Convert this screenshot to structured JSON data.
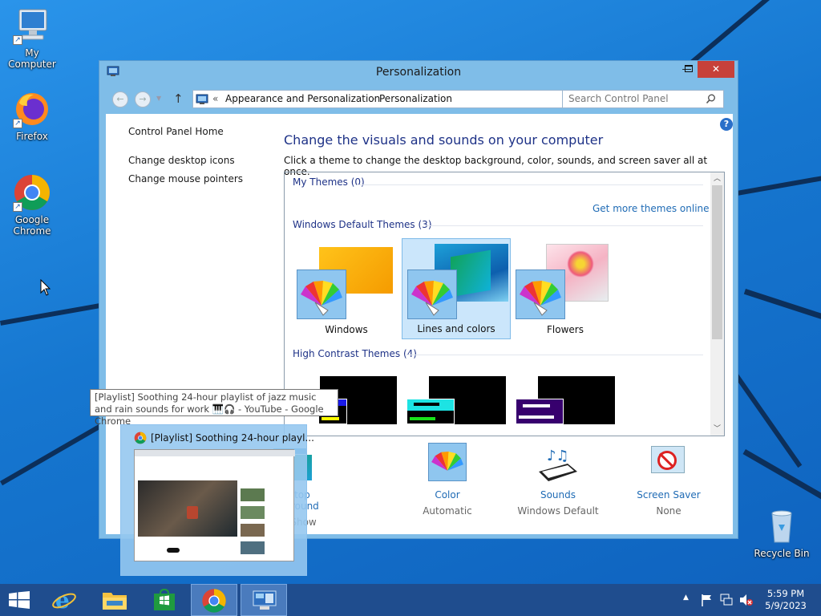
{
  "desktop": {
    "icons": [
      {
        "label": "My Computer"
      },
      {
        "label": "Firefox"
      },
      {
        "label": "Google Chrome"
      },
      {
        "label": "Recycle Bin"
      }
    ]
  },
  "window": {
    "title": "Personalization",
    "address": {
      "chevrons": "«",
      "crumb1": "Appearance and Personalization",
      "sep": "›",
      "crumb2": "Personalization"
    },
    "search_placeholder": "Search Control Panel",
    "left_nav": {
      "home": "Control Panel Home",
      "desktop_icons": "Change desktop icons",
      "mouse_pointers": "Change mouse pointers"
    },
    "heading": "Change the visuals and sounds on your computer",
    "subtext": "Click a theme to change the desktop background, color, sounds, and screen saver all at once.",
    "themes": {
      "my_themes": "My Themes (0)",
      "get_more": "Get more themes online",
      "default_group": "Windows Default Themes (3)",
      "items": [
        {
          "name": "Windows"
        },
        {
          "name": "Lines and colors",
          "selected": true
        },
        {
          "name": "Flowers"
        }
      ],
      "high_contrast_group": "High Contrast Themes (4)"
    },
    "bottom": [
      {
        "link": "Desktop Background",
        "value": "Slide Show"
      },
      {
        "link": "Color",
        "value": "Automatic"
      },
      {
        "link": "Sounds",
        "value": "Windows Default"
      },
      {
        "link": "Screen Saver",
        "value": "None"
      }
    ]
  },
  "preview": {
    "title": "[Playlist] Soothing 24-hour playl...",
    "tooltip": "[Playlist] Soothing 24-hour playlist of jazz music and rain sounds for work 🎹🎧 - YouTube - Google Chrome"
  },
  "taskbar": {
    "time": "5:59 PM",
    "date": "5/9/2023"
  },
  "colors": {
    "accent": "#1f6bb5",
    "heading": "#1e3287",
    "taskbar": "#1f4d8e",
    "close": "#c7413a"
  }
}
